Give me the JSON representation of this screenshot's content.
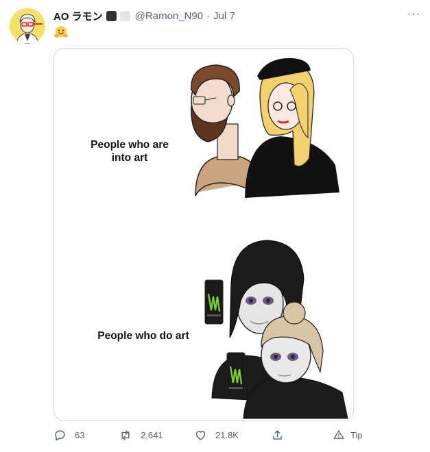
{
  "tweet": {
    "display_name": "AO ラモン",
    "handle": "@Ramon_N90",
    "separator": "·",
    "date": "Jul 7",
    "more_label": "···",
    "body_emoji": "hugging-face-emoji"
  },
  "meme": {
    "top_caption_line1": "People who are",
    "top_caption_line2": "into art",
    "bottom_caption": "People who do art"
  },
  "actions": {
    "replies": "63",
    "retweets": "2,641",
    "likes": "21.8K",
    "tip_label": "Tip"
  },
  "icons": [
    "reply-icon",
    "retweet-icon",
    "like-icon",
    "share-icon",
    "tip-icon",
    "more-icon"
  ],
  "colors": {
    "muted": "#536471",
    "avatar_bg": "#f7e06a",
    "card_border": "#cfd9de",
    "energy_green": "#7cd12e"
  }
}
